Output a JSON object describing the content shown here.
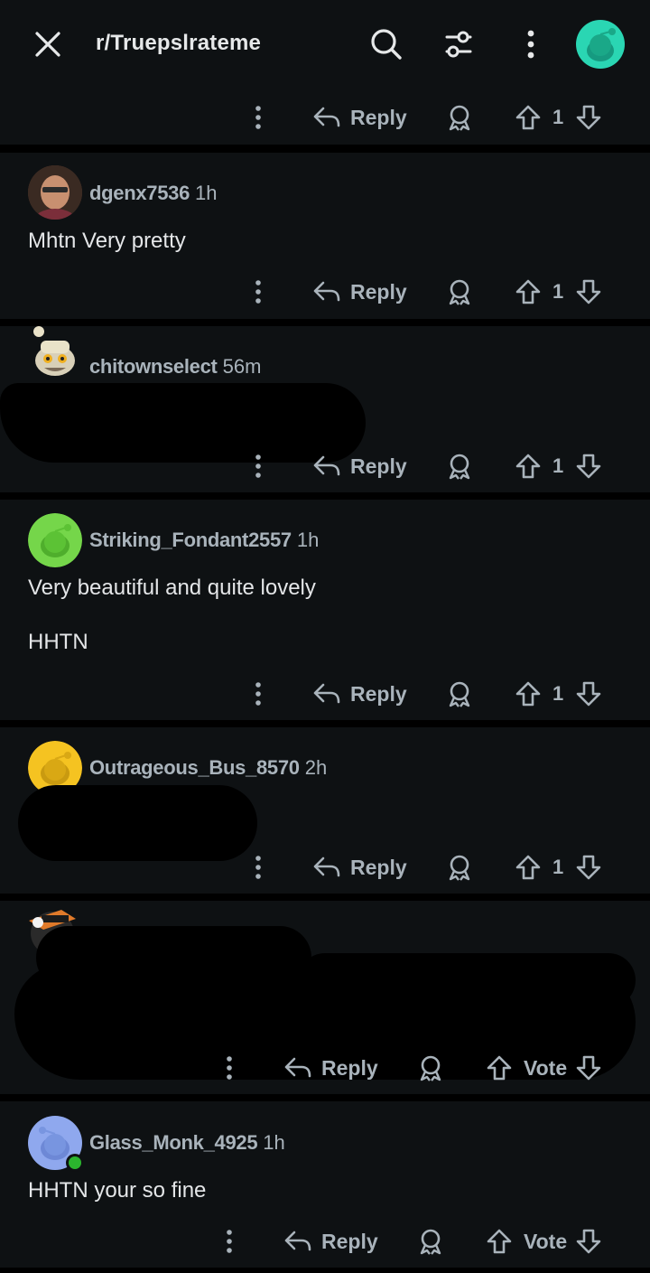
{
  "header": {
    "subreddit": "r/Truepslrateme",
    "icons": [
      "close-icon",
      "search-icon",
      "filter-icon",
      "more-icon",
      "avatar-icon"
    ]
  },
  "actions": {
    "reply": "Reply",
    "vote": "Vote"
  },
  "top_fragment": {
    "votes": "1"
  },
  "comments": [
    {
      "username": "dgenx7536",
      "time": "1h",
      "lines": [
        "Mhtn Very pretty"
      ],
      "votes": "1"
    },
    {
      "username": "chitownselect",
      "time": "56m",
      "lines": [],
      "votes": "1"
    },
    {
      "username": "Striking_Fondant2557",
      "time": "1h",
      "lines": [
        "Very beautiful and quite lovely",
        "HHTN"
      ],
      "votes": "1"
    },
    {
      "username": "Outrageous_Bus_8570",
      "time": "2h",
      "lines": [],
      "votes": "1"
    },
    {
      "username": "",
      "time": "",
      "lines": [],
      "votes": ""
    },
    {
      "username": "Glass_Monk_4925",
      "time": "1h",
      "lines": [
        "HHTN your so fine"
      ],
      "votes": ""
    }
  ],
  "colors": {
    "background": "#0e1113",
    "separator": "#000000",
    "text": "#e4e6e8",
    "meta": "#a9b3bb",
    "avatar_teal": "#2ad6b3",
    "avatar_green": "#75d64a",
    "avatar_yellow": "#f5c321",
    "avatar_blue": "#8fa8ee",
    "online": "#2bb52e"
  }
}
